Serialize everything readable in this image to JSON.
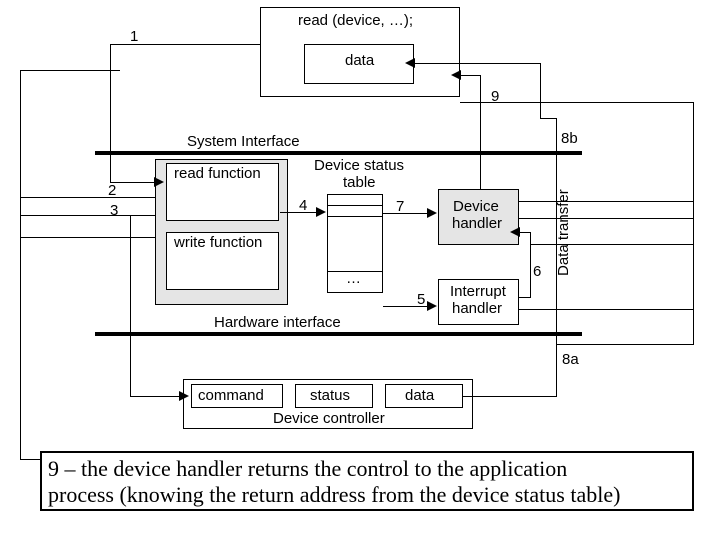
{
  "top": {
    "call": "read (device, …);",
    "data": "data"
  },
  "labels": {
    "sysIf": "System Interface",
    "hwIf": "Hardware interface",
    "readFn": "read function",
    "writeFn": "write function",
    "statusTbl1": "Device status",
    "statusTbl2": "table",
    "ellipsis": "…",
    "devHdl1": "Device",
    "devHdl2": "handler",
    "intHdl1": "Interrupt",
    "intHdl2": "handler",
    "command": "command",
    "status": "status",
    "dataReg": "data",
    "controller": "Device controller",
    "dataXfer": "Data transfer"
  },
  "steps": {
    "s1": "1",
    "s2": "2",
    "s3": "3",
    "s4": "4",
    "s5": "5",
    "s6": "6",
    "s7": "7",
    "s8a": "8a",
    "s8b": "8b",
    "s9": "9"
  },
  "caption": {
    "l1": "9 – the device handler returns the control to the application",
    "l2": "process (knowing the return address from the device status table)"
  }
}
